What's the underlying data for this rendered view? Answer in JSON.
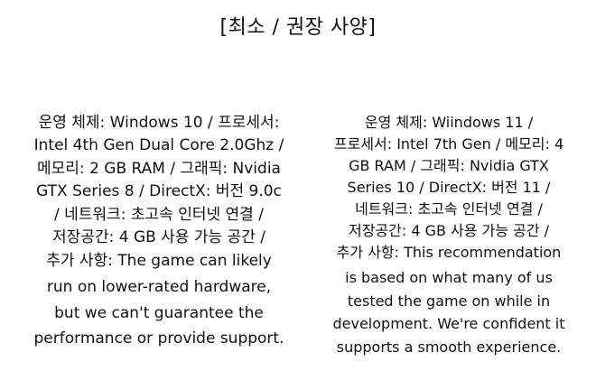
{
  "header": {
    "title": "[최소 / 권장 사양]"
  },
  "minimum": {
    "spec_lines": "운영 체제: Windows 10 / 프로세서:\nIntel 4th Gen Dual Core 2.0Ghz /\n메모리: 2 GB RAM / 그래픽: Nvidia\nGTX Series 8 / DirectX: 버전 9.0c\n/ 네트워크: 초고속 인터넷 연결 /\n저장공간: 4 GB 사용 가능 공간 /\n추가 사항: The game can likely",
    "note_lines": "run on lower-rated hardware,\nbut we can't guarantee the\nperformance or provide support."
  },
  "recommended": {
    "spec_lines": "운영 체제: Wiindows 11 /\n프로세서: Intel 7th Gen / 메모리: 4\nGB RAM / 그래픽: Nvidia GTX\nSeries 10 / DirectX: 버전 11 /\n네트워크: 초고속 인터넷 연결 /\n저장공간: 4 GB 사용 가능 공간 /\n추가 사항: This recommendation",
    "note_lines": "is based on what many of us\ntested the game on while in\ndevelopment. We're confident it\nsupports a smooth experience."
  }
}
